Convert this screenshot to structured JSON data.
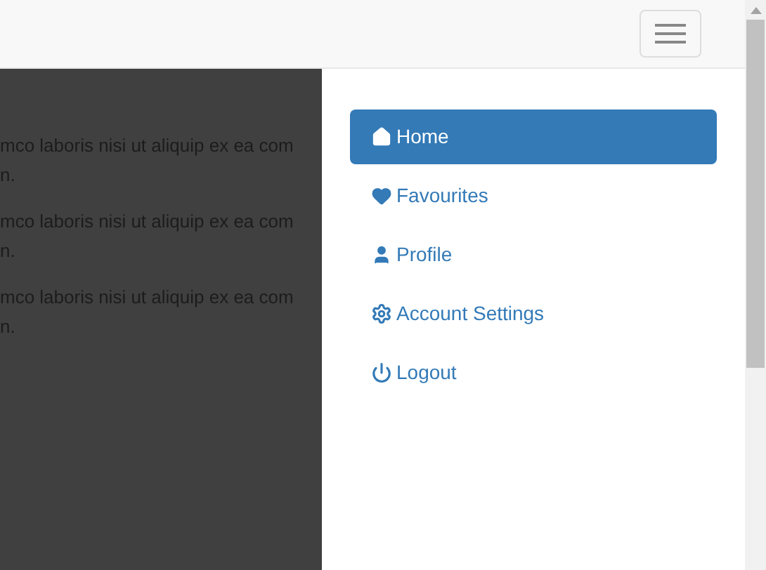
{
  "background_text": [
    {
      "line_1": "mco laboris nisi ut aliquip ex ea com",
      "line_2": "n."
    },
    {
      "line_1": "mco laboris nisi ut aliquip ex ea com",
      "line_2": "n."
    },
    {
      "line_1": "mco laboris nisi ut aliquip ex ea com",
      "line_2": "n."
    }
  ],
  "sidebar": {
    "items": [
      {
        "kind": "home",
        "label": "Home",
        "selected": true
      },
      {
        "kind": "heart",
        "label": "Favourites",
        "selected": false
      },
      {
        "kind": "user",
        "label": "Profile",
        "selected": false
      },
      {
        "kind": "gear",
        "label": "Account Settings",
        "selected": false
      },
      {
        "kind": "power",
        "label": "Logout",
        "selected": false
      }
    ]
  }
}
